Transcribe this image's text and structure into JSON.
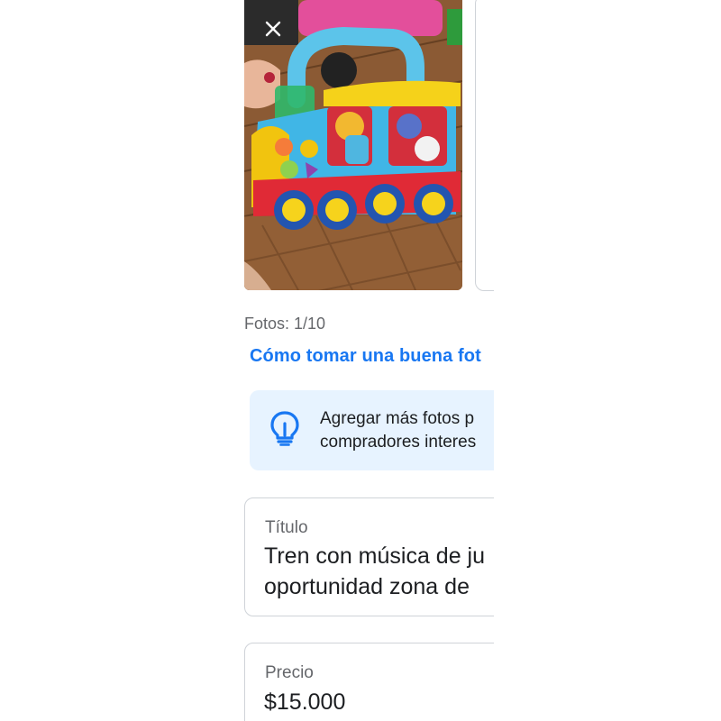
{
  "photos": {
    "count_label": "Fotos: 1/10",
    "tip_link": "Cómo tomar una buena fot",
    "remove_icon": "close-icon",
    "image_subject": "Tren de juguete con música"
  },
  "tip_banner": {
    "icon": "lightbulb-icon",
    "text": "Agregar más fotos p\ncompradores interes"
  },
  "listing": {
    "title": {
      "label": "Título",
      "value": "Tren con música de ju\noportunidad zona de"
    },
    "price": {
      "label": "Precio",
      "value": "$15.000"
    }
  },
  "colors": {
    "link": "#1877f2",
    "banner_bg": "#e7f3ff",
    "border": "#cfd3d8",
    "muted_text": "#65676b"
  }
}
